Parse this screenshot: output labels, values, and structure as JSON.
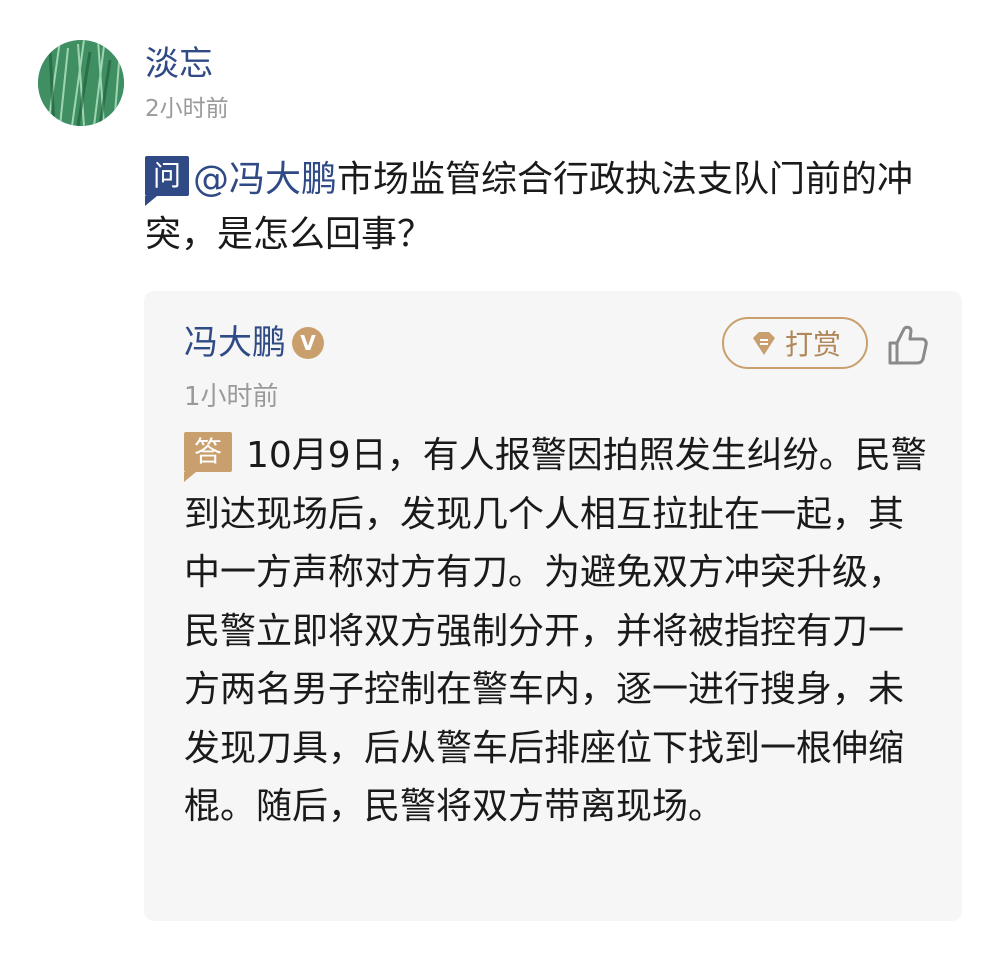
{
  "asker": {
    "name": "淡忘",
    "time": "2小时前",
    "avatar_icon": "grass-avatar"
  },
  "question": {
    "badge": "问",
    "mention": "@冯大鹏",
    "text": "市场监管综合行政执法支队门前的冲突，是怎么回事？"
  },
  "answer": {
    "author": "冯大鹏",
    "verified_icon": "verified-v-icon",
    "verified_glyph": "V",
    "tip_label": "打赏",
    "tip_icon": "gem-icon",
    "like_icon": "thumbs-up-icon",
    "time": "1小时前",
    "badge": "答",
    "text": "10月9日，有人报警因拍照发生纠纷。民警到达现场后，发现几个人相互拉扯在一起，其中一方声称对方有刀。为避免双方冲突升级，民警立即将双方强制分开，并将被指控有刀一方两名男子控制在警车内，逐一进行搜身，未发现刀具，后从警车后排座位下找到一根伸缩棍。随后，民警将双方带离现场。"
  },
  "colors": {
    "link_blue": "#2f4a85",
    "gold": "#c9a06d",
    "card_bg": "#f6f6f6",
    "muted_gray": "#9a9a9a"
  }
}
